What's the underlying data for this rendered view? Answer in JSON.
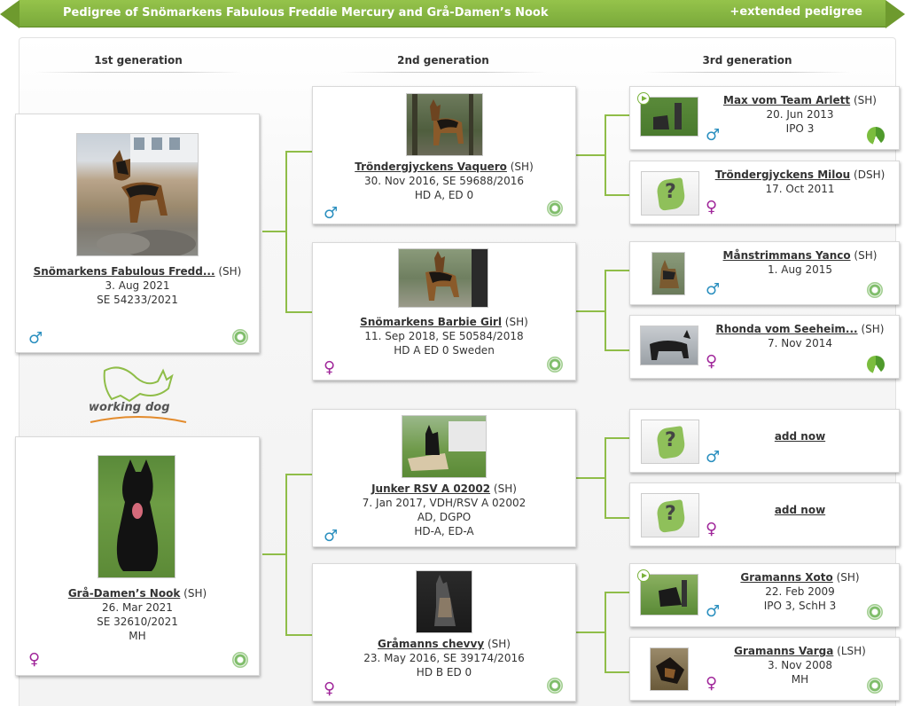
{
  "header": {
    "title": "Pedigree of Snömarkens Fabulous Freddie Mercury and Grå-Damen’s Nook",
    "extended_link": "+extended pedigree"
  },
  "generations": [
    "1st generation",
    "2nd generation",
    "3rd generation"
  ],
  "logo": {
    "word1": "working",
    "word2": "dog"
  },
  "colors": {
    "accent": "#8fbd48",
    "male": "#2a8fbf",
    "female": "#a0269a"
  },
  "gen1": [
    {
      "name": "Snömarkens Fabulous Fredd...",
      "reg": "(SH)",
      "lines": [
        "3. Aug 2021",
        "SE 54233/2021"
      ],
      "sex": "♂"
    },
    {
      "name": "Grå-Damen’s Nook",
      "reg": "(SH)",
      "lines": [
        "26. Mar 2021",
        "SE 32610/2021",
        "MH"
      ],
      "sex": "♀"
    }
  ],
  "gen2": [
    {
      "name": "Tröndergjyckens Vaquero",
      "reg": "(SH)",
      "lines": [
        "30. Nov 2016, SE 59688/2016",
        "HD A, ED 0"
      ],
      "sex": "♂"
    },
    {
      "name": "Snömarkens Barbie Girl",
      "reg": "(SH)",
      "lines": [
        "11. Sep 2018, SE 50584/2018",
        "HD A ED 0 Sweden"
      ],
      "sex": "♀"
    },
    {
      "name": "Junker RSV A 02002",
      "reg": "(SH)",
      "lines": [
        "7. Jan 2017, VDH/RSV A 02002",
        "AD, DGPO",
        "HD-A, ED-A"
      ],
      "sex": "♂"
    },
    {
      "name": "Gråmanns chevvy",
      "reg": "(SH)",
      "lines": [
        "23. May 2016, SE 39174/2016",
        "HD B ED 0"
      ],
      "sex": "♀"
    }
  ],
  "gen3": [
    {
      "name": "Max vom Team Arlett",
      "reg": "(SH)",
      "lines": [
        "20. Jun 2013",
        "IPO 3"
      ],
      "sex": "♂"
    },
    {
      "name": "Tröndergjyckens Milou",
      "reg": "(DSH)",
      "lines": [
        "17. Oct 2011"
      ],
      "sex": "♀"
    },
    {
      "name": "Månstrimmans Yanco",
      "reg": "(SH)",
      "lines": [
        "1. Aug 2015"
      ],
      "sex": "♂"
    },
    {
      "name": "Rhonda vom Seeheim...",
      "reg": "(SH)",
      "lines": [
        "7. Nov 2014"
      ],
      "sex": "♀"
    },
    {
      "name": "add now",
      "reg": "",
      "lines": [],
      "sex": "♂"
    },
    {
      "name": "add now",
      "reg": "",
      "lines": [],
      "sex": "♀"
    },
    {
      "name": "Gramanns Xoto",
      "reg": "(SH)",
      "lines": [
        "22. Feb 2009",
        "IPO 3, SchH 3"
      ],
      "sex": "♂"
    },
    {
      "name": "Gramanns Varga",
      "reg": "(LSH)",
      "lines": [
        "3. Nov 2008",
        "MH"
      ],
      "sex": "♀"
    }
  ]
}
